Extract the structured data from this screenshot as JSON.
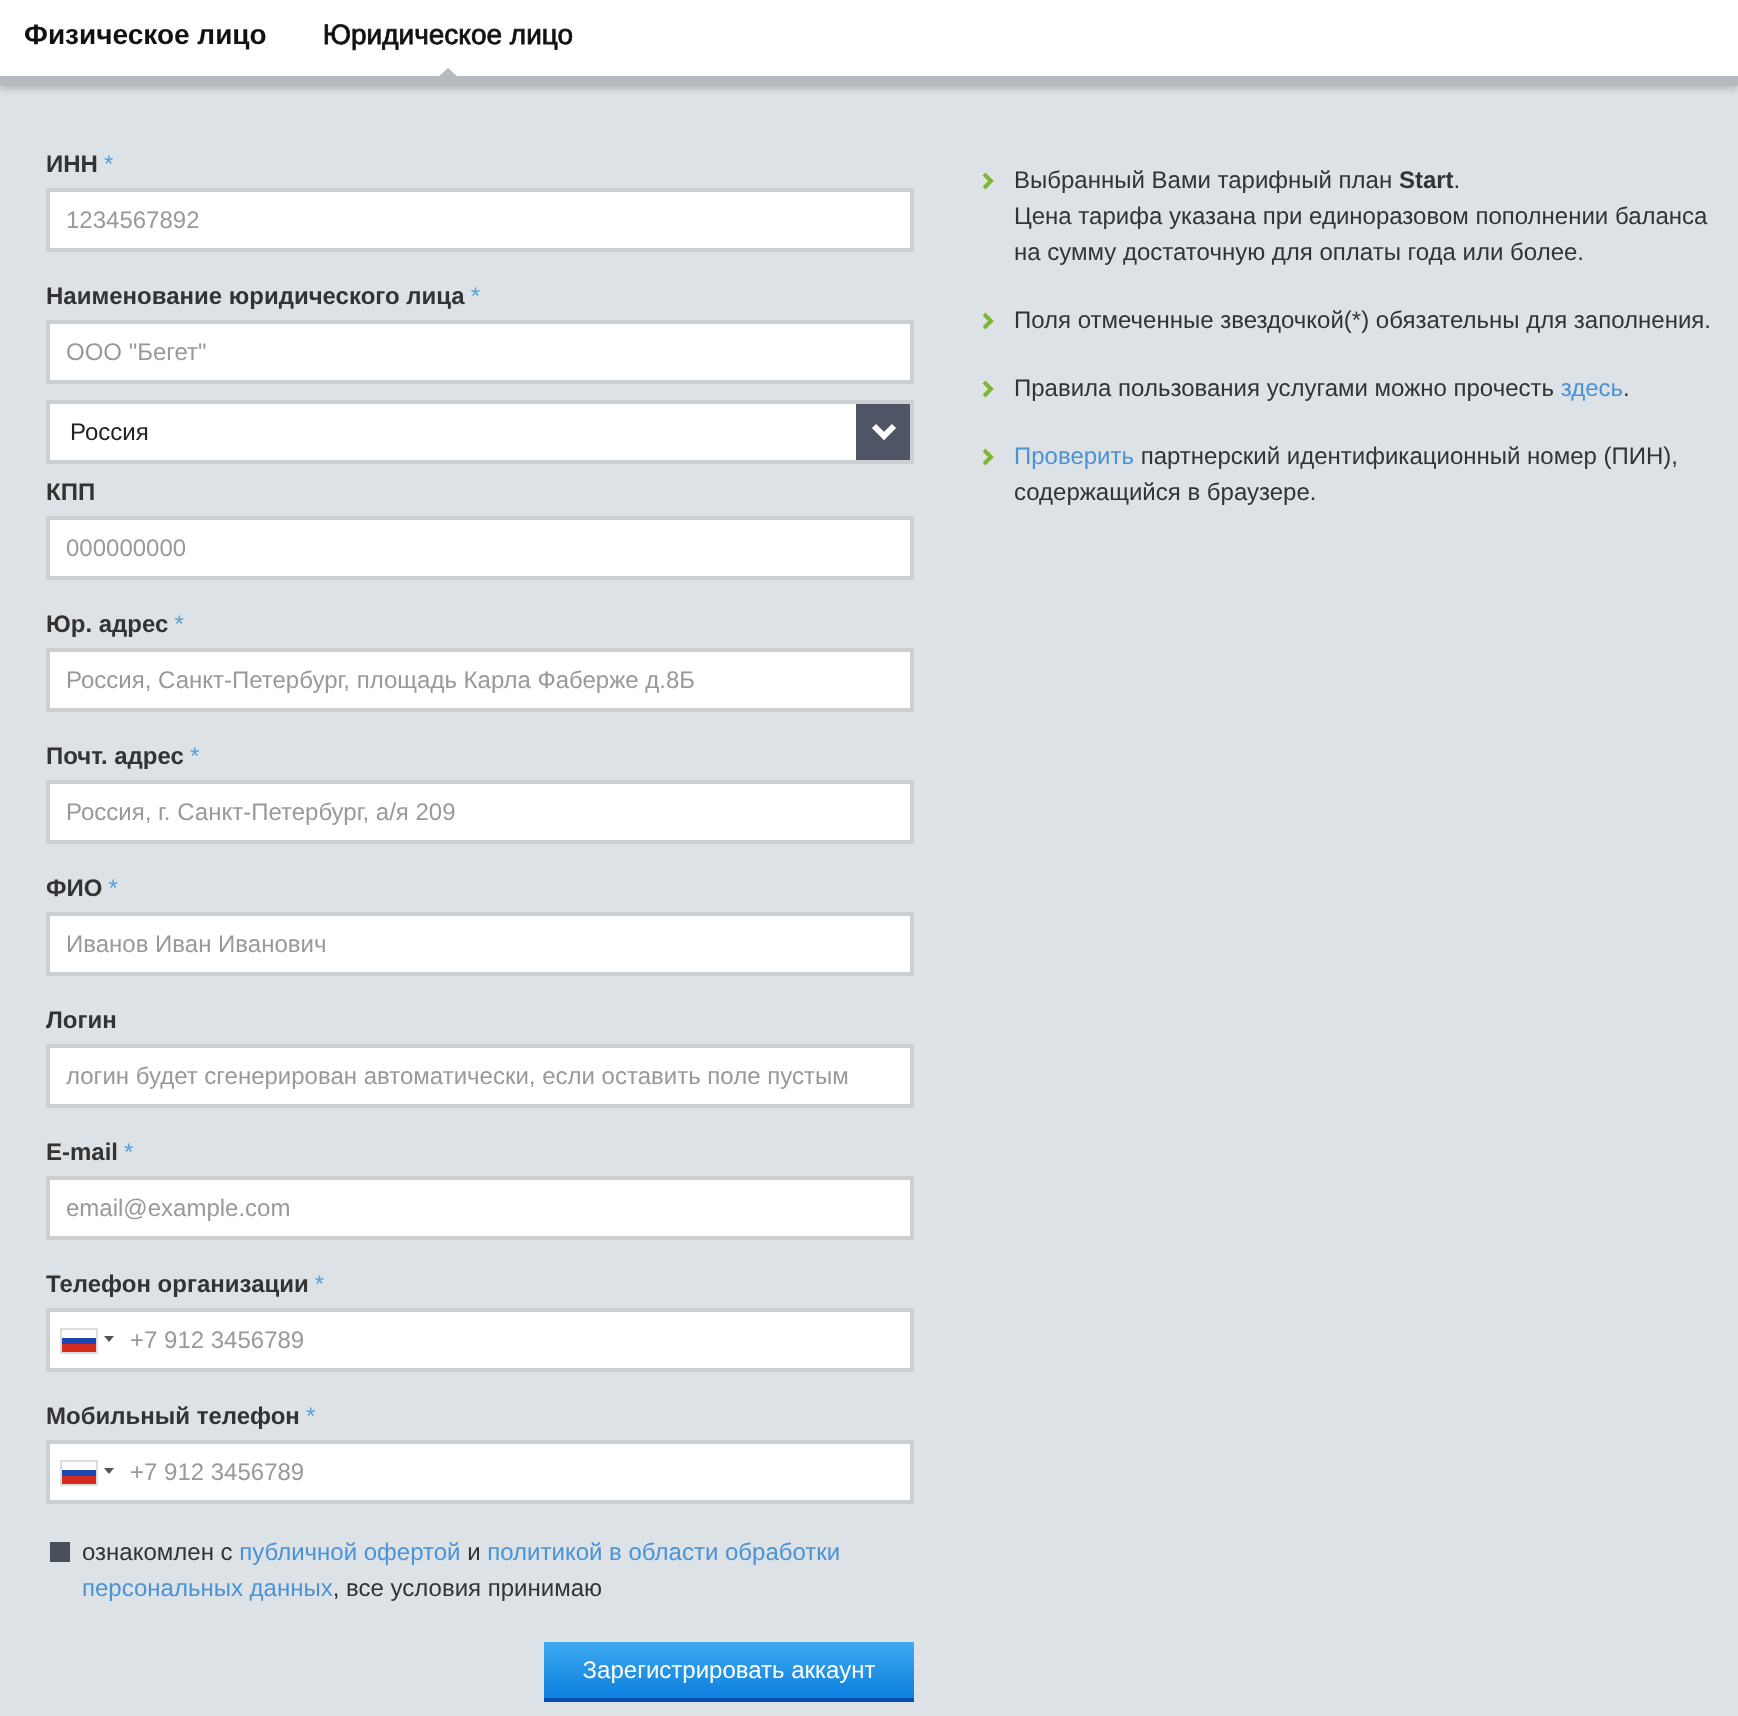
{
  "tabs": [
    {
      "label": "Физическое лицо",
      "selected": false
    },
    {
      "label": "Юридическое лицо",
      "selected": true
    }
  ],
  "fields": [
    {
      "kind": "text",
      "label": "ИНН",
      "required_mark": "*",
      "placeholder": "1234567892"
    },
    {
      "kind": "text",
      "label": "Наименование юридического лица",
      "required_mark": "*",
      "placeholder": "ООО \"Бегет\""
    },
    {
      "kind": "select",
      "value": "Россия"
    },
    {
      "kind": "text",
      "label": "КПП",
      "placeholder": "000000000"
    },
    {
      "kind": "text",
      "label": "Юр. адрес",
      "required_mark": "*",
      "placeholder": "Россия, Санкт-Петербург, площадь Карла Фаберже д.8Б"
    },
    {
      "kind": "text",
      "label": "Почт. адрес",
      "required_mark": "*",
      "placeholder": "Россия, г. Санкт-Петербург, а/я 209"
    },
    {
      "kind": "text",
      "label": "ФИО",
      "required_mark": "*",
      "placeholder": "Иванов Иван Иванович"
    },
    {
      "kind": "text",
      "label": "Логин",
      "placeholder": "логин будет сгенерирован автоматически, если оставить поле пустым"
    },
    {
      "kind": "text",
      "label": "E-mail",
      "required_mark": "*",
      "placeholder": "email@example.com"
    },
    {
      "kind": "phone",
      "label": "Телефон организации",
      "required_mark": "*",
      "placeholder": "+7 912 3456789"
    },
    {
      "kind": "phone",
      "label": "Мобильный телефон",
      "required_mark": "*",
      "placeholder": "+7 912 3456789"
    }
  ],
  "agreement_checked": false,
  "agreement": [
    {
      "kind": "text",
      "text": "ознакомлен с "
    },
    {
      "kind": "link",
      "text": "публичной офертой"
    },
    {
      "kind": "text",
      "text": " и "
    },
    {
      "kind": "link",
      "text": "политикой в области обработки"
    },
    {
      "kind": "link",
      "text": "персональных данных"
    },
    {
      "kind": "text",
      "text": ", все условия принимаю"
    }
  ],
  "submit": "Зарегистрировать аккаунт",
  "info": [
    {
      "lines": [
        [
          {
            "kind": "text",
            "text": "Выбранный Вами тарифный план **Start**."
          }
        ],
        [
          {
            "kind": "text",
            "text": "Цена тарифа указана при единоразовом пополнении баланса на сумму достаточную для оплаты года или более."
          }
        ]
      ]
    },
    {
      "lines": [
        [
          {
            "kind": "text",
            "text": "Поля отмеченные звездочкой(*) обязательны для заполнения."
          }
        ]
      ]
    },
    {
      "lines": [
        [
          {
            "kind": "text",
            "text": "Правила пользования услугами можно прочесть "
          },
          {
            "kind": "link",
            "text": "здесь"
          },
          {
            "kind": "text",
            "text": "."
          }
        ]
      ]
    },
    {
      "lines": [
        [
          {
            "kind": "link",
            "text": "Проверить"
          },
          {
            "kind": "text",
            "text": " партнерский идентификационный номер (ПИН), содержащийся в браузере."
          }
        ]
      ]
    }
  ]
}
